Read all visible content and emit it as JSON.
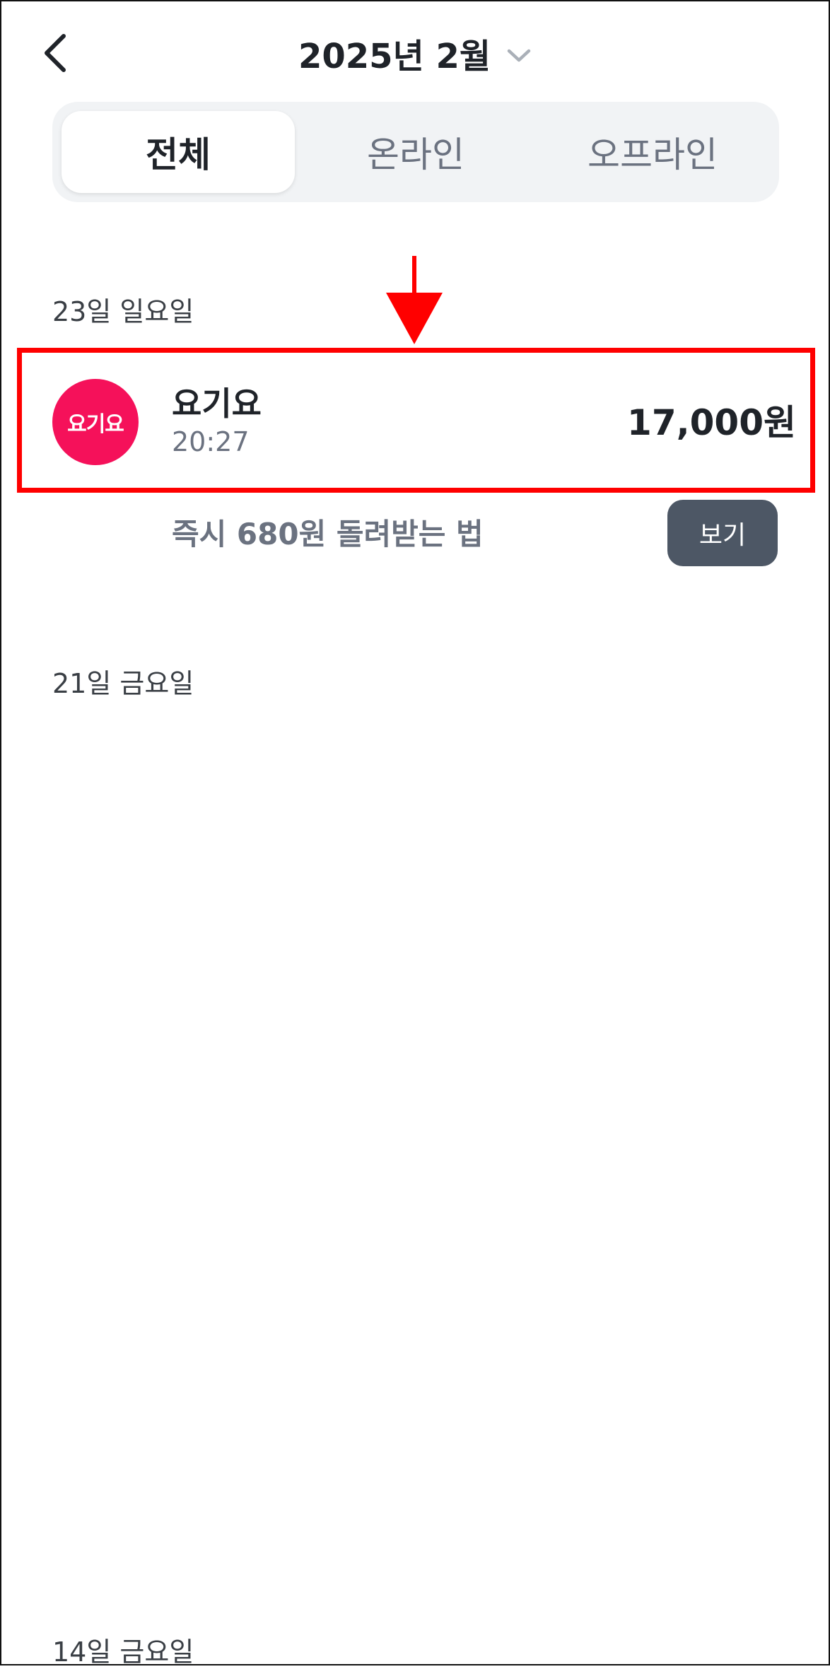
{
  "header": {
    "title": "2025년 2월"
  },
  "tabs": [
    {
      "label": "전체",
      "active": true
    },
    {
      "label": "온라인",
      "active": false
    },
    {
      "label": "오프라인",
      "active": false
    }
  ],
  "sections": [
    {
      "date_label": "23일 일요일",
      "transactions": [
        {
          "logo_text": "요기요",
          "logo_color": "#f5115a",
          "merchant": "요기요",
          "time": "20:27",
          "amount": "17,000원"
        }
      ],
      "cashback": {
        "text": "즉시 680원 돌려받는 법",
        "button_label": "보기"
      }
    },
    {
      "date_label": "21일 금요일"
    },
    {
      "date_label": "14일 금요일"
    }
  ],
  "annotation": {
    "color": "#ff0000"
  },
  "icons": {
    "back": "chevron-left-icon",
    "dropdown": "chevron-down-icon"
  }
}
